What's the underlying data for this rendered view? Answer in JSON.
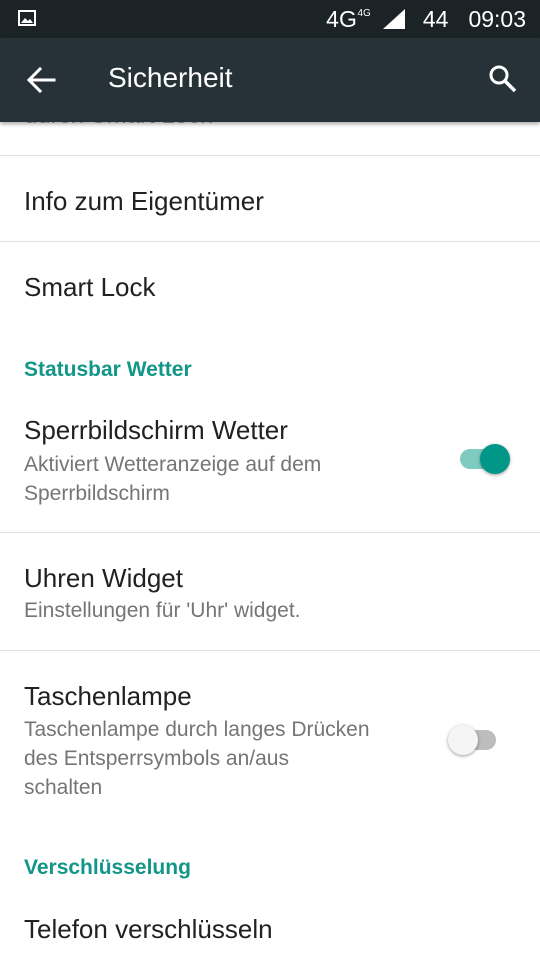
{
  "status_bar": {
    "network": "4G",
    "network_sup": "4G",
    "battery": "44",
    "time": "09:03",
    "icons": [
      "image-icon",
      "signal-icon"
    ]
  },
  "app_bar": {
    "title": "Sicherheit",
    "icons": [
      "back-arrow-icon",
      "search-icon"
    ]
  },
  "partial_item": "durch Smart Lock",
  "items": [
    {
      "title": "Info zum Eigentümer"
    },
    {
      "title": "Smart Lock"
    }
  ],
  "section_weather": "Statusbar Wetter",
  "weather_item": {
    "title": "Sperrbildschirm Wetter",
    "subtitle_line1": "Aktiviert Wetteranzeige auf dem",
    "subtitle_line2": "Sperrbildschirm",
    "toggle_on": true
  },
  "clock_item": {
    "title": "Uhren Widget",
    "subtitle": "Einstellungen für 'Uhr' widget."
  },
  "torch_item": {
    "title": "Taschenlampe",
    "subtitle_line1": "Taschenlampe durch langes Drücken",
    "subtitle_line2": "des Entsperrsymbols an/aus",
    "subtitle_line3": "schalten",
    "toggle_on": false
  },
  "section_encryption": "Verschlüsselung",
  "encrypt_item": {
    "title": "Telefon verschlüsseln"
  },
  "colors": {
    "accent": "#009688",
    "section_text": "#13968a",
    "appbar": "#263238",
    "statusbar": "#1b2326"
  }
}
